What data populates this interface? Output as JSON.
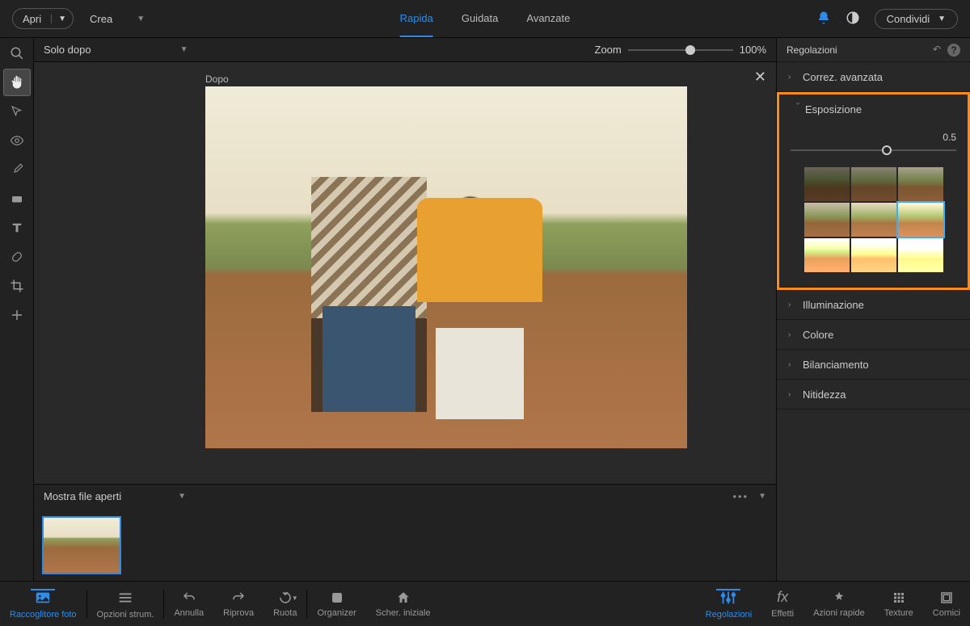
{
  "topbar": {
    "open": "Apri",
    "create": "Crea",
    "share": "Condividi"
  },
  "tabs": {
    "rapida": "Rapida",
    "guidata": "Guidata",
    "avanzate": "Avanzate"
  },
  "viewbar": {
    "mode": "Solo dopo",
    "zoom_label": "Zoom",
    "zoom_value": "100%"
  },
  "canvas": {
    "after_label": "Dopo"
  },
  "files": {
    "show_open": "Mostra file aperti"
  },
  "panel": {
    "title": "Regolazioni",
    "smart": "Correz. avanzata",
    "exposure": "Esposizione",
    "exposure_value": "0.5",
    "lighting": "Illuminazione",
    "color": "Colore",
    "balance": "Bilanciamento",
    "sharpness": "Nitidezza"
  },
  "bottom": {
    "photo_bin": "Raccoglitore foto",
    "tool_options": "Opzioni strum.",
    "undo": "Annulla",
    "redo": "Riprova",
    "rotate": "Ruota",
    "organizer": "Organizer",
    "home": "Scher. iniziale",
    "adjustments": "Regolazioni",
    "effects": "Effetti",
    "quick_actions": "Azioni rapide",
    "texture": "Texture",
    "frames": "Cornici"
  }
}
